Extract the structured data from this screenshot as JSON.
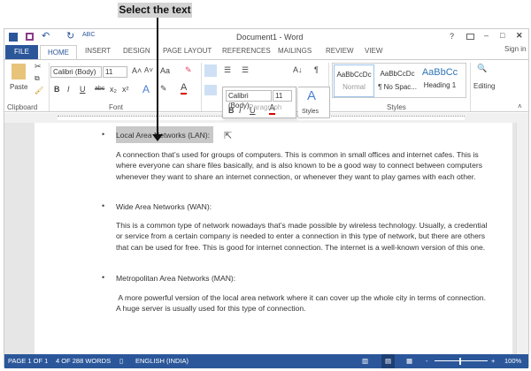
{
  "annotation": {
    "callout": "Select the text"
  },
  "window": {
    "title": "Document1 - Word",
    "controls": [
      "?",
      "restore",
      "–",
      "□",
      "✕"
    ],
    "sign_in": "Sign in"
  },
  "tabs": [
    "FILE",
    "HOME",
    "INSERT",
    "DESIGN",
    "PAGE LAYOUT",
    "REFERENCES",
    "MAILINGS",
    "REVIEW",
    "VIEW"
  ],
  "ribbon": {
    "clipboard": {
      "label": "Clipboard",
      "paste": "Paste"
    },
    "font": {
      "label": "Font",
      "name": "Calibri (Body)",
      "size": "11",
      "bold": "B",
      "italic": "I",
      "underline": "U",
      "strike": "abc",
      "sub": "x₂",
      "sup": "x²",
      "grow": "A˄",
      "shrink": "A˅",
      "case": "Aa"
    },
    "paragraph": {
      "label": "Paragraph",
      "pilcrow": "¶",
      "sort": "A↓"
    },
    "styles": {
      "label": "Styles",
      "items": [
        {
          "preview": "AaBbCcDc",
          "name": "Normal"
        },
        {
          "preview": "AaBbCcDc",
          "name": "¶ No Spac..."
        },
        {
          "preview": "AaBbCc",
          "name": "Heading 1"
        }
      ]
    },
    "editing": {
      "label": "Editing"
    }
  },
  "mini_toolbar": {
    "font": "Calibri (Body)",
    "size": "11",
    "styles": "Styles"
  },
  "document": {
    "sections": [
      {
        "heading": "Local Area Networks (LAN):",
        "body": "A connection that’s used for groups of computers. This is common in small offices and internet cafes. This is where everyone can share files basically, and is also known to be a good way to connect between computers whenever they want to share an internet connection, or whenever they want to play games with each other."
      },
      {
        "heading": "Wide Area Networks (WAN):",
        "body": "This is a common type of network nowadays that’s made possible by wireless technology. Usually, a credential or service from a certain company is needed to enter a connection in this type of network, but there are others that can be used for free. This is good for internet connection. The internet is a well-known version of this one."
      },
      {
        "heading": "Metropolitan Area Networks (MAN):",
        "body": " A more powerful version of the local area network where it can cover up the whole city in terms of connection. A huge server is usually used for this type of connection."
      }
    ]
  },
  "status": {
    "page": "PAGE 1 OF 1",
    "words": "4 OF 288 WORDS",
    "language": "ENGLISH (INDIA)",
    "zoom": "100%",
    "zoom_minus": "-",
    "zoom_plus": "+"
  },
  "colors": {
    "accent": "#2b579a",
    "selection": "#c8c8c8"
  }
}
